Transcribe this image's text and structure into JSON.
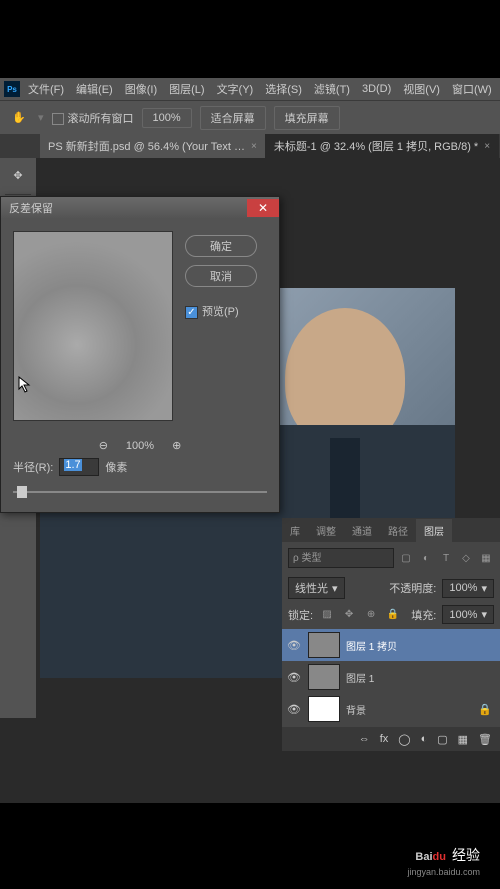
{
  "menu": {
    "file": "文件(F)",
    "edit": "编辑(E)",
    "image": "图像(I)",
    "layer": "图层(L)",
    "type": "文字(Y)",
    "select": "选择(S)",
    "filter": "滤镜(T)",
    "threeD": "3D(D)",
    "view": "视图(V)",
    "window": "窗口(W)"
  },
  "options": {
    "scroll_all": "滚动所有窗口",
    "zoom": "100%",
    "fit": "适合屏幕",
    "fill": "填充屏幕"
  },
  "tabs": {
    "t1": "PS 新新封面.psd @ 56.4% (Your Text …",
    "t2": "未标题-1 @ 32.4% (图层 1 拷贝, RGB/8) *"
  },
  "dialog": {
    "title": "反差保留",
    "ok": "确定",
    "cancel": "取消",
    "preview": "预览(P)",
    "zoom": "100%",
    "radius_label": "半径(R):",
    "radius_value": "1.7",
    "radius_unit": "像素"
  },
  "panels": {
    "tabs": {
      "lib": "库",
      "adjust": "调整",
      "channel": "通道",
      "path": "路径",
      "layer": "图层"
    },
    "search_placeholder": "ρ 类型",
    "blend": "线性光",
    "opacity_label": "不透明度:",
    "opacity": "100%",
    "lock_label": "锁定:",
    "fill_label": "填充:",
    "fill": "100%",
    "layers": [
      {
        "name": "图层 1 拷贝",
        "active": true
      },
      {
        "name": "图层 1",
        "active": false
      },
      {
        "name": "背景",
        "active": false,
        "white": true
      }
    ]
  },
  "watermark": {
    "brand": "Bai",
    "brand2": "du",
    "suffix": "经验",
    "url": "jingyan.baidu.com"
  }
}
